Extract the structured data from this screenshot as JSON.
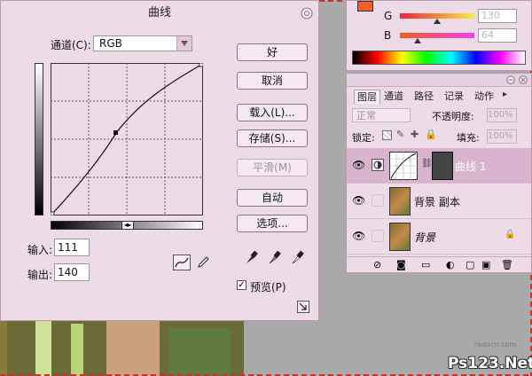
{
  "dialog": {
    "title": "曲线",
    "channel_label": "通道(C):",
    "channel_value": "RGB",
    "input_label": "输入:",
    "input_value": "111",
    "output_label": "输出:",
    "output_value": "140",
    "preview_label": "预览(P)",
    "buttons": {
      "ok": "好",
      "cancel": "取消",
      "load": "载入(L)...",
      "save": "存储(S)...",
      "smooth": "平滑(M)",
      "auto": "自动",
      "options": "选项..."
    }
  },
  "color_panel": {
    "g_label": "G",
    "g_value": "130",
    "b_label": "B",
    "b_value": "64"
  },
  "layers_panel": {
    "tabs": [
      "图层",
      "通道",
      "路径",
      "记录",
      "动作"
    ],
    "blend_mode": "正常",
    "opacity_label": "不透明度:",
    "opacity_value": "100%",
    "lock_label": "锁定:",
    "fill_label": "填充:",
    "fill_value": "100%",
    "layers": [
      {
        "name": "曲线 1",
        "selected": true
      },
      {
        "name": "背景 副本",
        "selected": false
      },
      {
        "name": "背景",
        "selected": false
      }
    ]
  },
  "watermark": {
    "small": "redocn.com",
    "large": "Ps123.Net"
  },
  "colors": {
    "panel_bg": "#eedbe8",
    "selected_layer": "#d9b4cf",
    "photo_border": "#c33333"
  }
}
